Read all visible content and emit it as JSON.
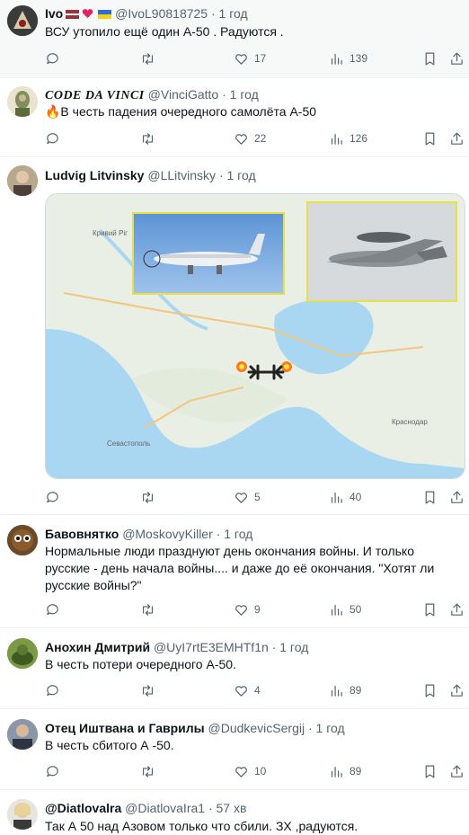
{
  "tweets": [
    {
      "name": "Ivo",
      "handle": "@IvoL90818725",
      "time": "1 год",
      "text": "ВСУ утопило ещё один А-50  . Радуются .",
      "stats": {
        "reply": "",
        "retweet": "",
        "like": "17",
        "views": "139"
      },
      "flags": [
        "latvia-flag",
        "red-heart",
        "ukraine-flag"
      ]
    },
    {
      "name": "CODE DA VINCI",
      "handle": "@VinciGatto",
      "time": "1 год",
      "text": "🔥В честь падения очередного самолёта А-50",
      "stats": {
        "reply": "",
        "retweet": "",
        "like": "22",
        "views": "126"
      }
    },
    {
      "name": "Ludvig Litvinsky",
      "handle": "@LLitvinsky",
      "time": "1 год",
      "text": "",
      "stats": {
        "reply": "",
        "retweet": "",
        "like": "5",
        "views": "40"
      },
      "map_labels": {
        "sevastopol": "Севастополь",
        "krasnodar": "Краснодар",
        "kryvyi_rih": "Кривий Ріг"
      }
    },
    {
      "name": "Бавовнятко",
      "handle": "@MoskovyKiller",
      "time": "1 год",
      "text": "Нормальные люди празднуют день окончания войны. И только русские - день начала войны.... и даже до её окончания. \"Хотят ли русские войны?\"",
      "stats": {
        "reply": "",
        "retweet": "",
        "like": "9",
        "views": "50"
      }
    },
    {
      "name": "Анохин Дмитрий",
      "handle": "@UyI7rtE3EMHTf1n",
      "time": "1 год",
      "text": "В честь потери очередного А-50.",
      "stats": {
        "reply": "",
        "retweet": "",
        "like": "4",
        "views": "89"
      }
    },
    {
      "name": "Отец Иштвана и Гаврилы",
      "handle": "@DudkevicSergij",
      "time": "1 год",
      "text": "В честь сбитого А -50.",
      "stats": {
        "reply": "",
        "retweet": "",
        "like": "10",
        "views": "89"
      }
    },
    {
      "name": "@Diatlovalra",
      "handle": "@DiatlovaIra1",
      "time": "57 хв",
      "text": "Так А 50 над Азовом только что сбили. ЗХ ,радуются.",
      "stats": {
        "reply": "",
        "retweet": "",
        "like": "",
        "views": ""
      }
    }
  ],
  "separator": "·",
  "colors": {
    "text": "#0f1419",
    "muted": "#536471",
    "border": "#eff3f4",
    "sea": "#a9d7f2",
    "land": "#e9efe4"
  },
  "icons": [
    "reply-icon",
    "retweet-icon",
    "like-icon",
    "views-icon",
    "bookmark-icon",
    "share-icon"
  ]
}
